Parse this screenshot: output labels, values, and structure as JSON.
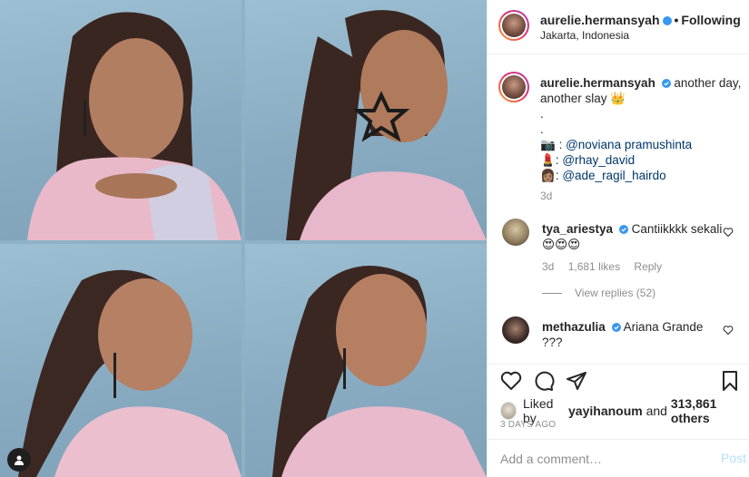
{
  "post": {
    "author": "aurelie.hermansyah",
    "separator": "•",
    "follow_status": "Following",
    "location": "Jakarta, Indonesia"
  },
  "caption": {
    "username": "aurelie.hermansyah",
    "text": "another day, another slay 👑",
    "dot1": ".",
    "dot2": ".",
    "credits": [
      {
        "emoji": "📷",
        "sep": " : ",
        "handle": "@noviana pramushinta"
      },
      {
        "emoji": "💄",
        "sep": ": ",
        "handle": "@rhay_david"
      },
      {
        "emoji": "👩🏽",
        "sep": ": ",
        "handle": "@ade_ragil_hairdo"
      }
    ],
    "time": "3d"
  },
  "comments": [
    {
      "username": "tya_ariestya",
      "text": "Cantiikkkk sekali",
      "text2": "😍😍😍",
      "time": "3d",
      "likes": "1,681 likes",
      "reply": "Reply",
      "view_replies": "View replies (52)"
    },
    {
      "username": "methazulia",
      "text": "Ariana Grande",
      "text2": "???"
    }
  ],
  "liked_by": {
    "prefix": "Liked by ",
    "user": "yayihanoum",
    "middle": " and ",
    "count": "313,861 others"
  },
  "date": "3 DAYS AGO",
  "add_comment": {
    "placeholder": "Add a comment…",
    "post_label": "Post"
  },
  "colors": {
    "verified": "#3897f0",
    "link": "#00376b",
    "post_disabled": "#b2dffc",
    "backdrop": "#8fb1c6"
  }
}
